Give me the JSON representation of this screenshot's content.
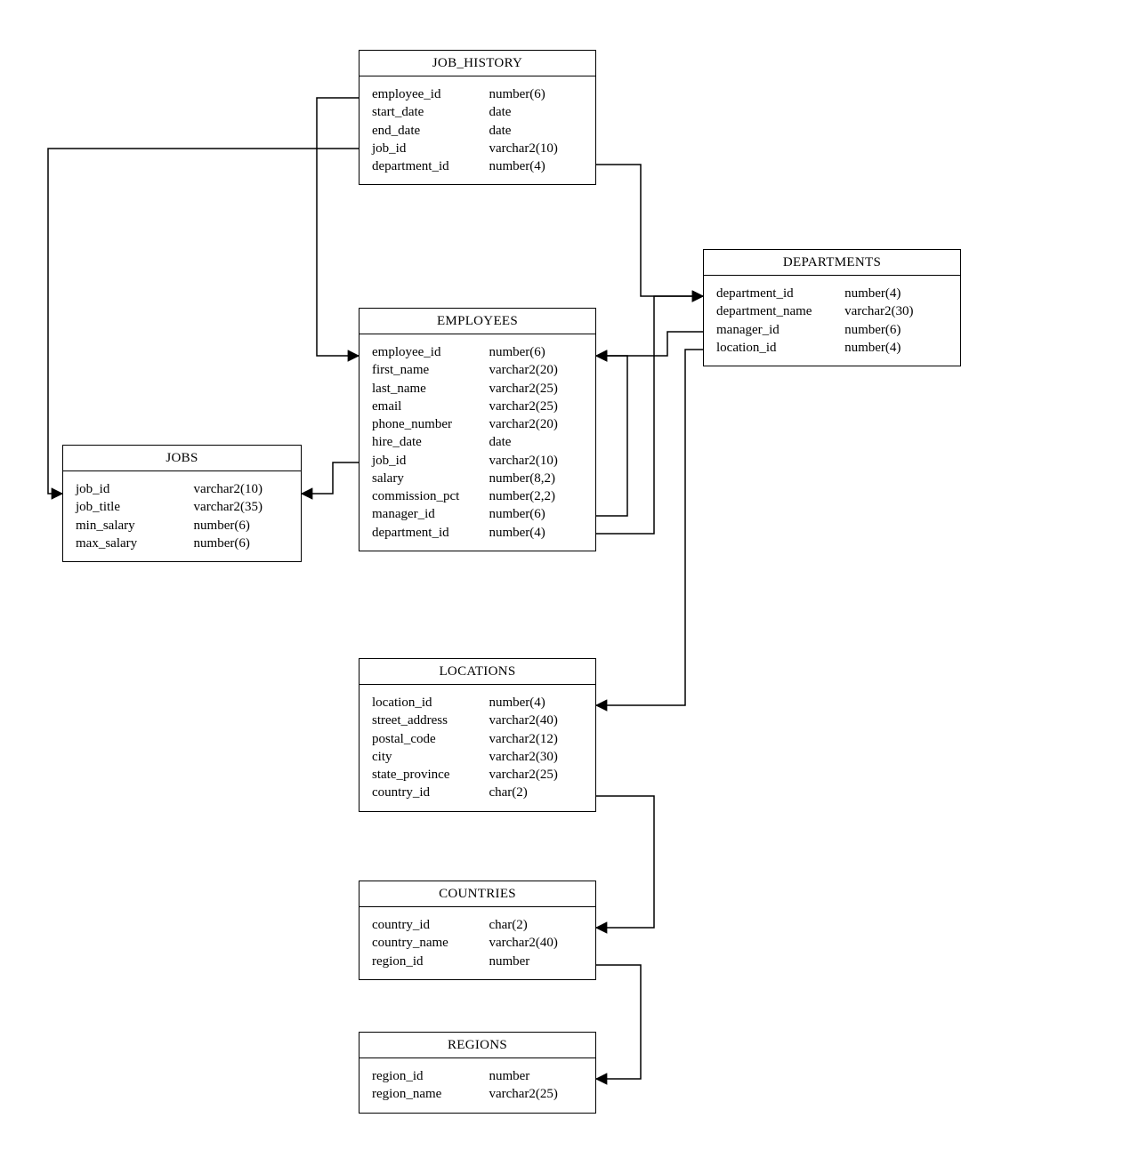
{
  "entities": {
    "job_history": {
      "title": "JOB_HISTORY",
      "cols": [
        {
          "name": "employee_id",
          "type": "number(6)"
        },
        {
          "name": "start_date",
          "type": "date"
        },
        {
          "name": "end_date",
          "type": "date"
        },
        {
          "name": "job_id",
          "type": "varchar2(10)"
        },
        {
          "name": "department_id",
          "type": "number(4)"
        }
      ]
    },
    "employees": {
      "title": "EMPLOYEES",
      "cols": [
        {
          "name": "employee_id",
          "type": "number(6)"
        },
        {
          "name": "first_name",
          "type": "varchar2(20)"
        },
        {
          "name": "last_name",
          "type": "varchar2(25)"
        },
        {
          "name": "email",
          "type": "varchar2(25)"
        },
        {
          "name": "phone_number",
          "type": "varchar2(20)"
        },
        {
          "name": "hire_date",
          "type": "date"
        },
        {
          "name": "job_id",
          "type": "varchar2(10)"
        },
        {
          "name": "salary",
          "type": "number(8,2)"
        },
        {
          "name": "commission_pct",
          "type": "number(2,2)"
        },
        {
          "name": "manager_id",
          "type": "number(6)"
        },
        {
          "name": "department_id",
          "type": "number(4)"
        }
      ]
    },
    "jobs": {
      "title": "JOBS",
      "cols": [
        {
          "name": "job_id",
          "type": "varchar2(10)"
        },
        {
          "name": "job_title",
          "type": "varchar2(35)"
        },
        {
          "name": "min_salary",
          "type": "number(6)"
        },
        {
          "name": "max_salary",
          "type": "number(6)"
        }
      ]
    },
    "departments": {
      "title": "DEPARTMENTS",
      "cols": [
        {
          "name": "department_id",
          "type": "number(4)"
        },
        {
          "name": "department_name",
          "type": "varchar2(30)"
        },
        {
          "name": "manager_id",
          "type": "number(6)"
        },
        {
          "name": "location_id",
          "type": "number(4)"
        }
      ]
    },
    "locations": {
      "title": "LOCATIONS",
      "cols": [
        {
          "name": "location_id",
          "type": "number(4)"
        },
        {
          "name": "street_address",
          "type": "varchar2(40)"
        },
        {
          "name": "postal_code",
          "type": "varchar2(12)"
        },
        {
          "name": "city",
          "type": "varchar2(30)"
        },
        {
          "name": "state_province",
          "type": "varchar2(25)"
        },
        {
          "name": "country_id",
          "type": "char(2)"
        }
      ]
    },
    "countries": {
      "title": "COUNTRIES",
      "cols": [
        {
          "name": "country_id",
          "type": "char(2)"
        },
        {
          "name": "country_name",
          "type": "varchar2(40)"
        },
        {
          "name": "region_id",
          "type": "number"
        }
      ]
    },
    "regions": {
      "title": "REGIONS",
      "cols": [
        {
          "name": "region_id",
          "type": "number"
        },
        {
          "name": "region_name",
          "type": "varchar2(25)"
        }
      ]
    }
  },
  "relationships": [
    {
      "from": "job_history.employee_id",
      "to": "employees.employee_id"
    },
    {
      "from": "job_history.job_id",
      "to": "jobs.job_id"
    },
    {
      "from": "job_history.department_id",
      "to": "departments.department_id"
    },
    {
      "from": "employees.job_id",
      "to": "jobs.job_id"
    },
    {
      "from": "employees.manager_id",
      "to": "employees.employee_id"
    },
    {
      "from": "employees.department_id",
      "to": "departments.department_id"
    },
    {
      "from": "departments.manager_id",
      "to": "employees.employee_id"
    },
    {
      "from": "departments.location_id",
      "to": "locations.location_id"
    },
    {
      "from": "locations.country_id",
      "to": "countries.country_id"
    },
    {
      "from": "countries.region_id",
      "to": "regions.region_id"
    }
  ]
}
